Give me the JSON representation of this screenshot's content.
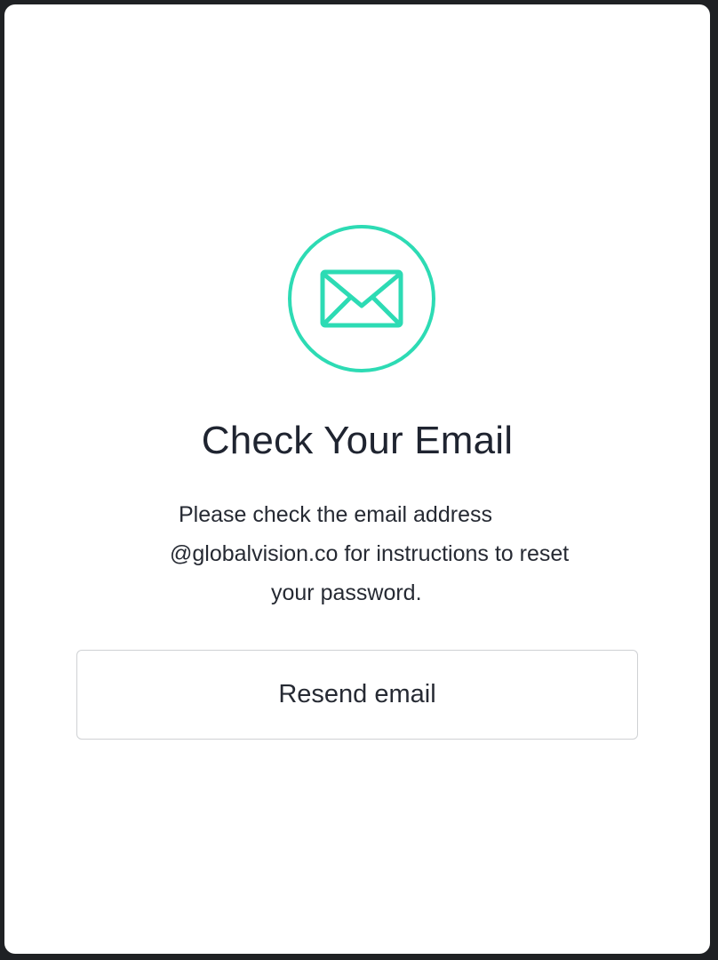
{
  "accent_color": "#2ddbb4",
  "icon": "envelope-icon",
  "title": "Check Your Email",
  "message": {
    "line1": "Please check the email address",
    "line2": "@globalvision.co for instructions to reset",
    "line3": "your password."
  },
  "resend_button_label": "Resend email"
}
